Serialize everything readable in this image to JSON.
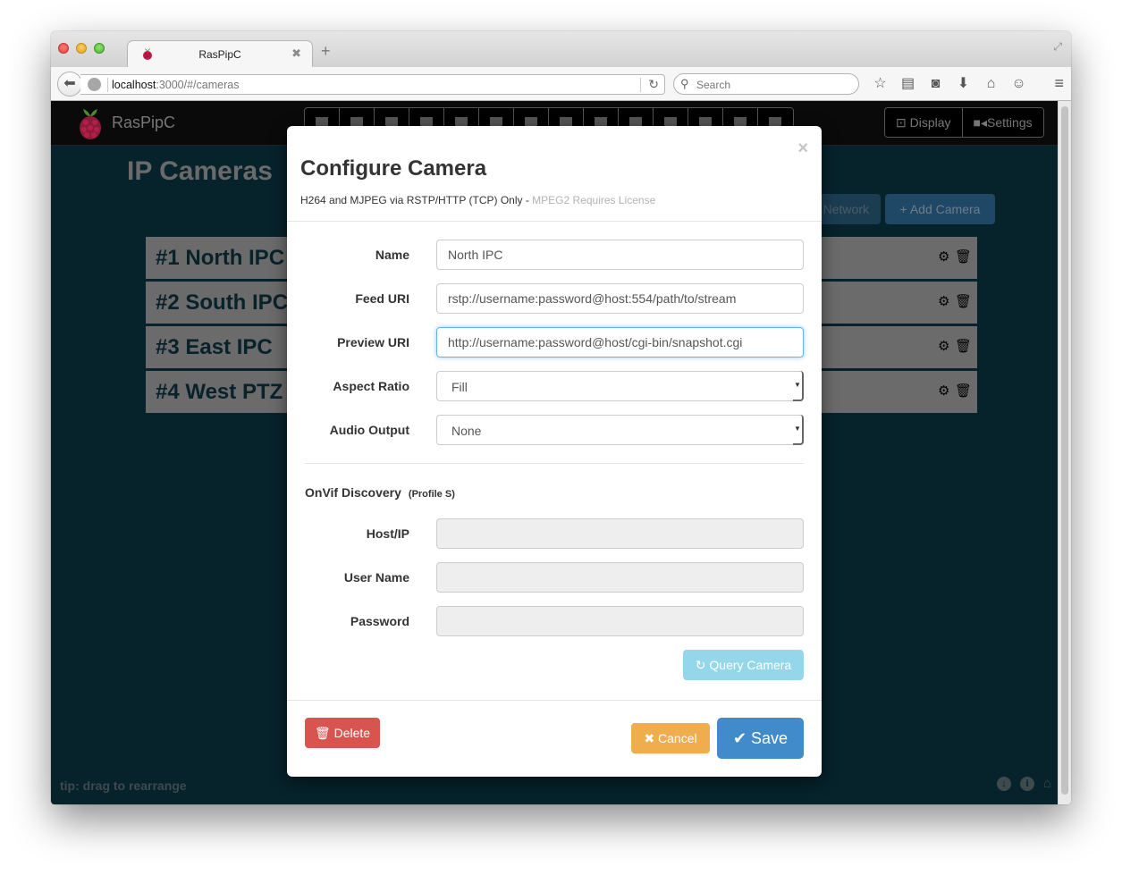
{
  "browser": {
    "tab_title": "RasPipC",
    "url_host": "localhost",
    "url_rest": ":3000/#/cameras",
    "search_placeholder": "Search",
    "toolbar_icons": [
      "bookmark-star-icon",
      "reading-list-icon",
      "pocket-icon",
      "download-icon",
      "home-icon",
      "chat-icon"
    ]
  },
  "app": {
    "brand": "RasPipC",
    "layout_buttons": [
      "layout-1",
      "layout-2h",
      "layout-2v",
      "layout-3",
      "layout-4",
      "layout-1-wide",
      "layout-1-alt",
      "layout-5",
      "layout-6",
      "layout-7",
      "layout-8",
      "layout-9",
      "layout-10",
      "layout-16"
    ],
    "nav": {
      "display_label": "Display",
      "settings_label": "Settings"
    },
    "page_title": "IP Cameras",
    "network_label": "Network",
    "add_camera_label": "+ Add Camera",
    "cameras": [
      {
        "label": "#1 North IPC"
      },
      {
        "label": "#2 South IPC"
      },
      {
        "label": "#3 East IPC"
      },
      {
        "label": "#4 West PTZ"
      }
    ],
    "tip": "tip: drag to rearrange"
  },
  "modal": {
    "title": "Configure Camera",
    "subtitle": "H264 and MJPEG via RSTP/HTTP (TCP) Only - ",
    "subtitle_muted": "MPEG2 Requires License",
    "close_glyph": "×",
    "fields": {
      "name": {
        "label": "Name",
        "value": "North IPC"
      },
      "feed_uri": {
        "label": "Feed URI",
        "value": "rstp://username:password@host:554/path/to/stream"
      },
      "preview_uri": {
        "label": "Preview URI",
        "value": "http://username:password@host/cgi-bin/snapshot.cgi"
      },
      "aspect_ratio": {
        "label": "Aspect Ratio",
        "value": "Fill"
      },
      "audio_output": {
        "label": "Audio Output",
        "value": "None"
      }
    },
    "onvif": {
      "title": "OnVif Discovery",
      "subtitle": "(Profile S)",
      "host_label": "Host/IP",
      "host_value": "",
      "user_label": "User Name",
      "user_value": "",
      "password_label": "Password",
      "password_value": "",
      "query_label": "Query Camera"
    },
    "buttons": {
      "delete": "Delete",
      "cancel": "Cancel",
      "save": "Save"
    }
  },
  "colors": {
    "page_bg": "#06222b",
    "primary": "#428bca",
    "danger": "#d9534f",
    "warning": "#f0ad4e",
    "info_disabled": "#94d6ea"
  }
}
